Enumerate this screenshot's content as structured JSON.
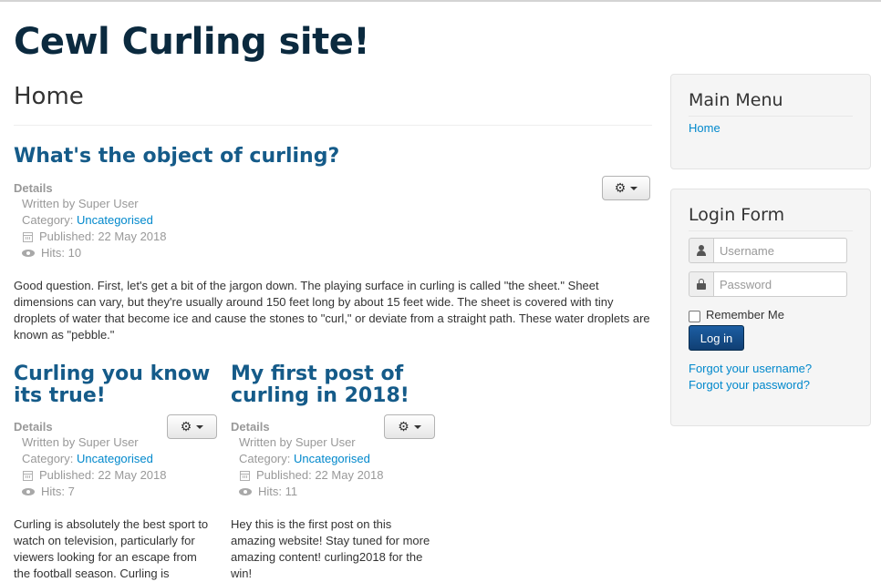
{
  "site": {
    "title": "Cewl Curling site!"
  },
  "page": {
    "title": "Home"
  },
  "articles": [
    {
      "title": "What's the object of curling?",
      "details_label": "Details",
      "author": "Written by Super User",
      "category_label": "Category:",
      "category": "Uncategorised",
      "published": "Published: 22 May 2018",
      "hits": "Hits: 10",
      "body": "Good question. First, let's get a bit of the jargon down. The playing surface in curling is called \"the sheet.\" Sheet dimensions can vary, but they're usually around 150 feet long by about 15 feet wide. The sheet is covered with tiny droplets of water that become ice and cause the stones to \"curl,\" or deviate from a straight path. These water droplets are known as \"pebble.\""
    },
    {
      "title": "Curling you know its true!",
      "details_label": "Details",
      "author": "Written by Super User",
      "category_label": "Category:",
      "category": "Uncategorised",
      "published": "Published: 22 May 2018",
      "hits": "Hits: 7",
      "body": "Curling is absolutely the best sport to watch on television, particularly for viewers looking for an escape from the football season. Curling is"
    },
    {
      "title": "My first post of curling in 2018!",
      "details_label": "Details",
      "author": "Written by Super User",
      "category_label": "Category:",
      "category": "Uncategorised",
      "published": "Published: 22 May 2018",
      "hits": "Hits: 11",
      "body": "Hey this is the first post on this amazing website! Stay tuned for more amazing content! curling2018 for the win!"
    }
  ],
  "icons": {
    "tools": "gear-icon",
    "caret": "caret-down-icon",
    "published": "calendar-icon",
    "hits": "eye-icon",
    "username": "user-icon",
    "password": "lock-icon"
  },
  "main_menu": {
    "title": "Main Menu",
    "items": [
      {
        "label": "Home"
      }
    ]
  },
  "login": {
    "title": "Login Form",
    "username_placeholder": "Username",
    "password_placeholder": "Password",
    "remember_label": "Remember Me",
    "submit_label": "Log in",
    "forgot_username": "Forgot your username?",
    "forgot_password": "Forgot your password?"
  },
  "colors": {
    "site_title": "#0b2a3f",
    "article_title": "#155b89",
    "link": "#08c",
    "login_button": "#155390"
  }
}
